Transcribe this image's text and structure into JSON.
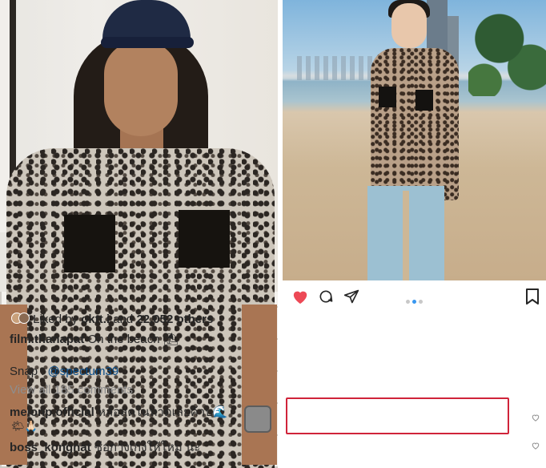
{
  "post": {
    "likes": {
      "liked_by_label": "Liked by",
      "liked_by_user": "oktt.i",
      "and_label": "and",
      "others_count": "22,052 others"
    },
    "caption": {
      "username": "film.thanapat",
      "text": "On the beach",
      "emoji": "⛱"
    },
    "snap": {
      "label": "Snap :",
      "mention": "@spectum39"
    },
    "view_all_comments": "View all 185 comments",
    "comments": [
      {
        "username": "melonp.official",
        "text": "หล่อสุดในหาดเลยค้าบ🌊",
        "text_line2": "🌤🙏🏻"
      },
      {
        "username": "boss_kongnat",
        "text": "ซือกางเกงให้ใหม่ นะ"
      }
    ],
    "carousel": {
      "count": 3,
      "active": 1
    }
  },
  "colors": {
    "like_red": "#ed4956",
    "highlight_border": "#d0243a",
    "mention_blue": "#0a4e8a",
    "muted_gray": "#8e8e8e"
  },
  "icons": [
    "heart-icon",
    "comment-icon",
    "share-icon",
    "bookmark-icon"
  ]
}
